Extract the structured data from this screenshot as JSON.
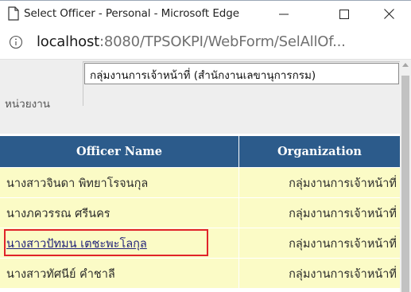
{
  "window": {
    "title": "Select Officer - Personal - Microsoft Edge",
    "icons": {
      "page": "page-icon",
      "minimize": "minimize-icon",
      "maximize": "maximize-icon",
      "close": "close-icon"
    }
  },
  "address": {
    "info_icon": "info-icon",
    "host": "localhost",
    "rest": ":8080/TPSOKPI/WebForm/SelAllOf..."
  },
  "form": {
    "unit_label": "หน่วยงาน",
    "unit_value": "กลุ่มงานการเจ้าหน้าที่ (สำนักงานเลขานุการกรม)"
  },
  "grid": {
    "headers": {
      "name": "Officer Name",
      "organization": "Organization"
    },
    "rows": [
      {
        "name": "นางสาวจินดา พิทยาโรจนกุล",
        "organization": "กลุ่มงานการเจ้าหน้าที่",
        "link": false
      },
      {
        "name": "นางภควรรณ ศรีนคร",
        "organization": "กลุ่มงานการเจ้าหน้าที่",
        "link": false
      },
      {
        "name": "นางสาวปัทมน เตชะพะโลกุล",
        "organization": "กลุ่มงานการเจ้าหน้าที่",
        "link": true,
        "highlighted": true
      },
      {
        "name": "นางสาวทัศนีย์ คำชาลี",
        "organization": "กลุ่มงานการเจ้าหน้าที่",
        "link": false
      }
    ]
  },
  "colors": {
    "header_bg": "#2c5b8b",
    "row_bg": "#fbfbc6",
    "highlight": "#e0232a",
    "link": "#22227a"
  }
}
